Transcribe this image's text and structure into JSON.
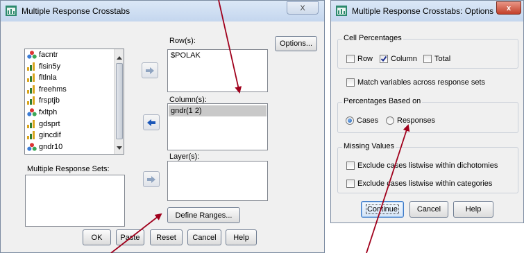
{
  "main": {
    "title": "Multiple Response Crosstabs",
    "close_glyph": "X",
    "variables": [
      {
        "name": "facntr",
        "icon": "nominal-icon"
      },
      {
        "name": "flsin5y",
        "icon": "scale-icon"
      },
      {
        "name": "fltlnla",
        "icon": "scale-icon"
      },
      {
        "name": "freehms",
        "icon": "scale-icon"
      },
      {
        "name": "frsptjb",
        "icon": "scale-icon"
      },
      {
        "name": "fxltph",
        "icon": "nominal-icon"
      },
      {
        "name": "gdsprt",
        "icon": "scale-icon"
      },
      {
        "name": "gincdif",
        "icon": "scale-icon"
      },
      {
        "name": "gndr10",
        "icon": "nominal-icon"
      }
    ],
    "mr_sets_label": "Multiple Response Sets:",
    "rows_label": "Row(s):",
    "rows_value": "$POLAK",
    "columns_label": "Column(s):",
    "columns_value": "gndr(1 2)",
    "layers_label": "Layer(s):",
    "options_button": "Options...",
    "define_ranges_button": "Define Ranges...",
    "ok_button": "OK",
    "paste_button": "Paste",
    "reset_button": "Reset",
    "cancel_button": "Cancel",
    "help_button": "Help"
  },
  "options": {
    "title": "Multiple Response Crosstabs: Options",
    "close_glyph": "x",
    "cell_percentages_label": "Cell Percentages",
    "row_label": "Row",
    "row_checked": false,
    "column_label": "Column",
    "column_checked": true,
    "total_label": "Total",
    "total_checked": false,
    "match_label": "Match variables across response sets",
    "match_checked": false,
    "based_on_label": "Percentages Based on",
    "cases_label": "Cases",
    "cases_selected": true,
    "responses_label": "Responses",
    "responses_selected": false,
    "missing_label": "Missing Values",
    "exclude_dich_label": "Exclude cases listwise within dichotomies",
    "exclude_dich_checked": false,
    "exclude_cat_label": "Exclude cases listwise within categories",
    "exclude_cat_checked": false,
    "continue_button": "Continue",
    "cancel_button": "Cancel",
    "help_button": "Help"
  },
  "colors": {
    "annotation_arrow": "#a0001c",
    "selected_row_bg": "#c9c9c9",
    "window_bg": "#f0f0f0"
  }
}
